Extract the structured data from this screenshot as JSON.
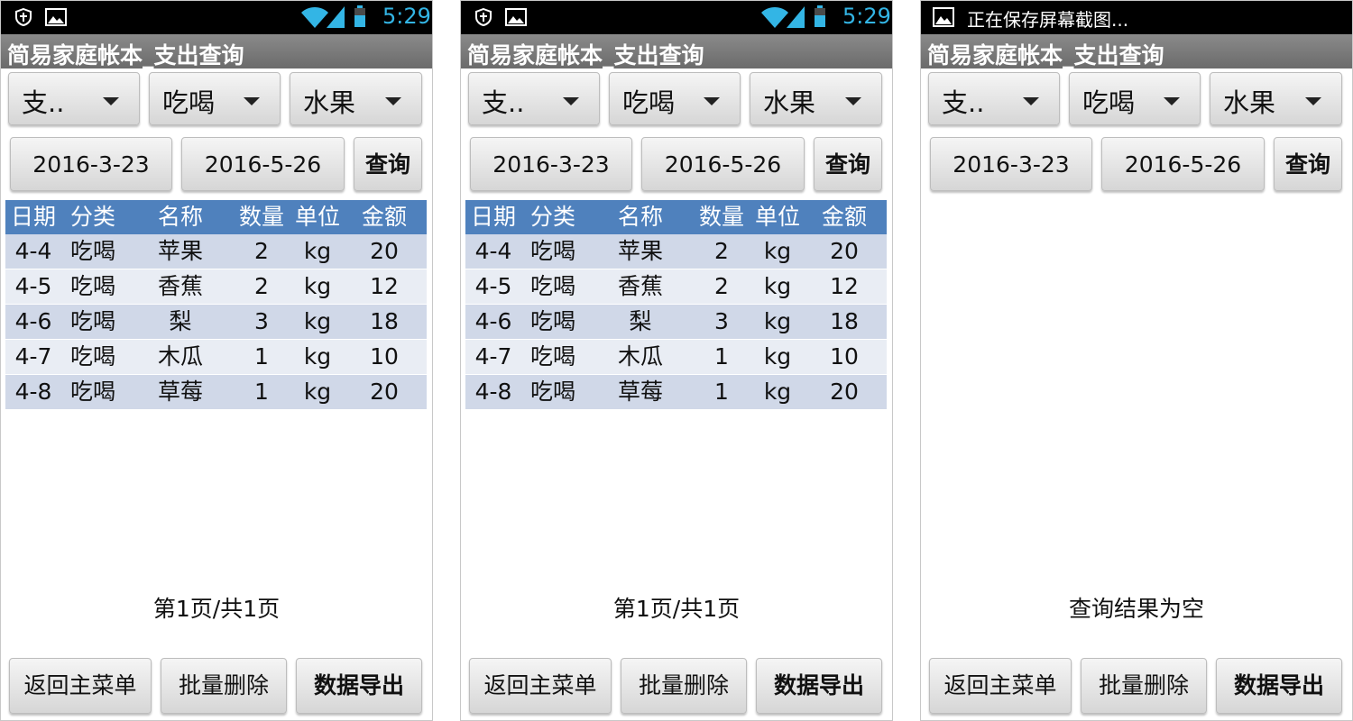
{
  "status_bar": {
    "time": "5:29",
    "saving_notice": "正在保存屏幕截图..."
  },
  "app": {
    "title": "简易家庭帐本_支出查询",
    "spinners": {
      "type": "支..",
      "category": "吃喝",
      "item": "水果"
    },
    "start_date": "2016-3-23",
    "end_date": "2016-5-26",
    "query_label": "查询",
    "table": {
      "headers": [
        "日期",
        "分类",
        "名称",
        "数量",
        "单位",
        "金额"
      ],
      "rows": [
        [
          "4-4",
          "吃喝",
          "苹果",
          "2",
          "kg",
          "20"
        ],
        [
          "4-5",
          "吃喝",
          "香蕉",
          "2",
          "kg",
          "12"
        ],
        [
          "4-6",
          "吃喝",
          "梨",
          "3",
          "kg",
          "18"
        ],
        [
          "4-7",
          "吃喝",
          "木瓜",
          "1",
          "kg",
          "10"
        ],
        [
          "4-8",
          "吃喝",
          "草莓",
          "1",
          "kg",
          "20"
        ]
      ]
    },
    "page_info": "第1页/共1页",
    "empty_result": "查询结果为空",
    "buttons": {
      "back": "返回主菜单",
      "batch_delete": "批量删除",
      "export": "数据导出"
    }
  },
  "colors": {
    "header_blue": "#4f81bd",
    "row_odd": "#d0d8e8",
    "row_even": "#e9edf4",
    "clock": "#33b5e5"
  }
}
